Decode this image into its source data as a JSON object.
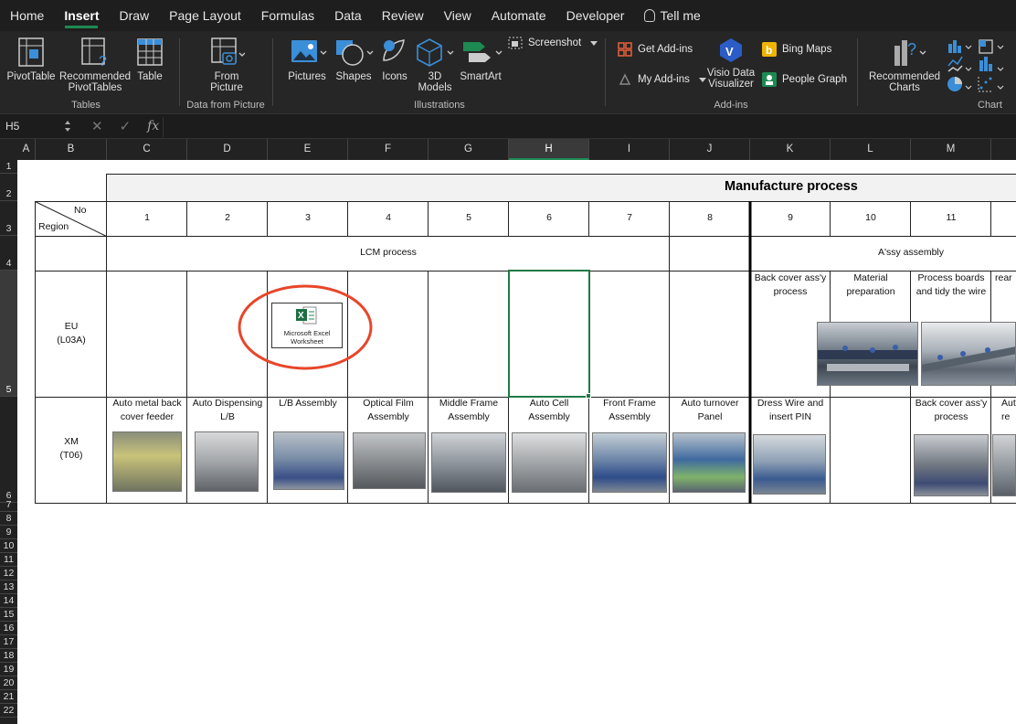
{
  "menu": {
    "tabs": [
      "Home",
      "Insert",
      "Draw",
      "Page Layout",
      "Formulas",
      "Data",
      "Review",
      "View",
      "Automate",
      "Developer",
      "Tell me"
    ],
    "active": "Insert"
  },
  "ribbon": {
    "pivottable": "PivotTable",
    "recommended_pivot": [
      "Recommended",
      "PivotTables"
    ],
    "table": "Table",
    "group_tables": "Tables",
    "from_picture": [
      "From",
      "Picture"
    ],
    "group_data_from_picture": "Data from Picture",
    "pictures": "Pictures",
    "shapes": "Shapes",
    "icons": "Icons",
    "models": [
      "3D",
      "Models"
    ],
    "smartart": "SmartArt",
    "screenshot": "Screenshot",
    "group_illustrations": "Illustrations",
    "get_addins": "Get Add-ins",
    "my_addins": "My Add-ins",
    "visio": [
      "Visio Data",
      "Visualizer"
    ],
    "bing_maps": "Bing Maps",
    "people_graph": "People Graph",
    "group_addins": "Add-ins",
    "recommended_charts": [
      "Recommended",
      "Charts"
    ],
    "group_charts": "Chart"
  },
  "formula_bar": {
    "name_box": "H5",
    "fx": "fx",
    "value": ""
  },
  "columns": [
    "A",
    "B",
    "C",
    "D",
    "E",
    "F",
    "G",
    "H",
    "I",
    "J",
    "K",
    "L",
    "M"
  ],
  "selected_column": "H",
  "rows": [
    "1",
    "2",
    "3",
    "4",
    "5",
    "6",
    "7",
    "8",
    "9",
    "10",
    "11",
    "12",
    "13",
    "14",
    "15",
    "16",
    "17",
    "18",
    "19",
    "20",
    "21",
    "22"
  ],
  "selected_row": "5",
  "sheet": {
    "title": "Manufacture process",
    "header_no": "No",
    "header_region": "Region",
    "numbers": [
      "1",
      "2",
      "3",
      "4",
      "5",
      "6",
      "7",
      "8",
      "9",
      "10",
      "11"
    ],
    "lcm_process": "LCM process",
    "assy_assembly": "A'ssy assembly",
    "eu_region": [
      "EU",
      "(L03A)"
    ],
    "xm_region": [
      "XM",
      "(T06)"
    ],
    "eu_steps": {
      "k": [
        "Back cover ass'y",
        "process"
      ],
      "l": [
        "Material",
        "preparation"
      ],
      "m": [
        "Process boards",
        "and tidy the wire"
      ],
      "n_partial": "rear"
    },
    "embedded_object": [
      "Microsoft Excel",
      "Worksheet"
    ],
    "xm_steps": [
      [
        "Auto metal back",
        "cover feeder"
      ],
      [
        "Auto Dispensing",
        "L/B"
      ],
      [
        "L/B Assembly",
        ""
      ],
      [
        "Optical Film",
        "Assembly"
      ],
      [
        "Middle Frame",
        "Assembly"
      ],
      [
        "Auto Cell",
        "Assembly"
      ],
      [
        "Front Frame",
        "Assembly"
      ],
      [
        "Auto turnover",
        "Panel"
      ],
      [
        "Dress Wire and",
        "insert PIN"
      ],
      [
        "",
        ""
      ],
      [
        "Back cover ass'y",
        "process"
      ],
      [
        "Aut",
        "re"
      ]
    ]
  },
  "colors": {
    "ribbon_bg": "#262626",
    "accent_green": "#1d8a52",
    "annotation_red": "#e8462a",
    "selection_green": "#1e7a45"
  }
}
